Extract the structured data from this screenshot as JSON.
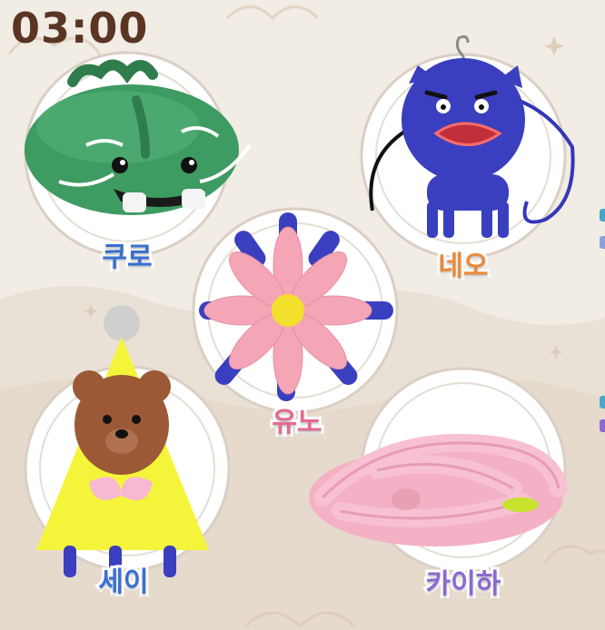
{
  "timer": {
    "text": "03:00"
  },
  "characters": [
    {
      "name": "쿠로",
      "color": "#3a6fd0"
    },
    {
      "name": "네오",
      "color": "#e98a3a"
    },
    {
      "name": "유노",
      "color": "#e36a90"
    },
    {
      "name": "세이",
      "color": "#3a6fd0"
    },
    {
      "name": "카이하",
      "color": "#8a6ad0"
    }
  ]
}
